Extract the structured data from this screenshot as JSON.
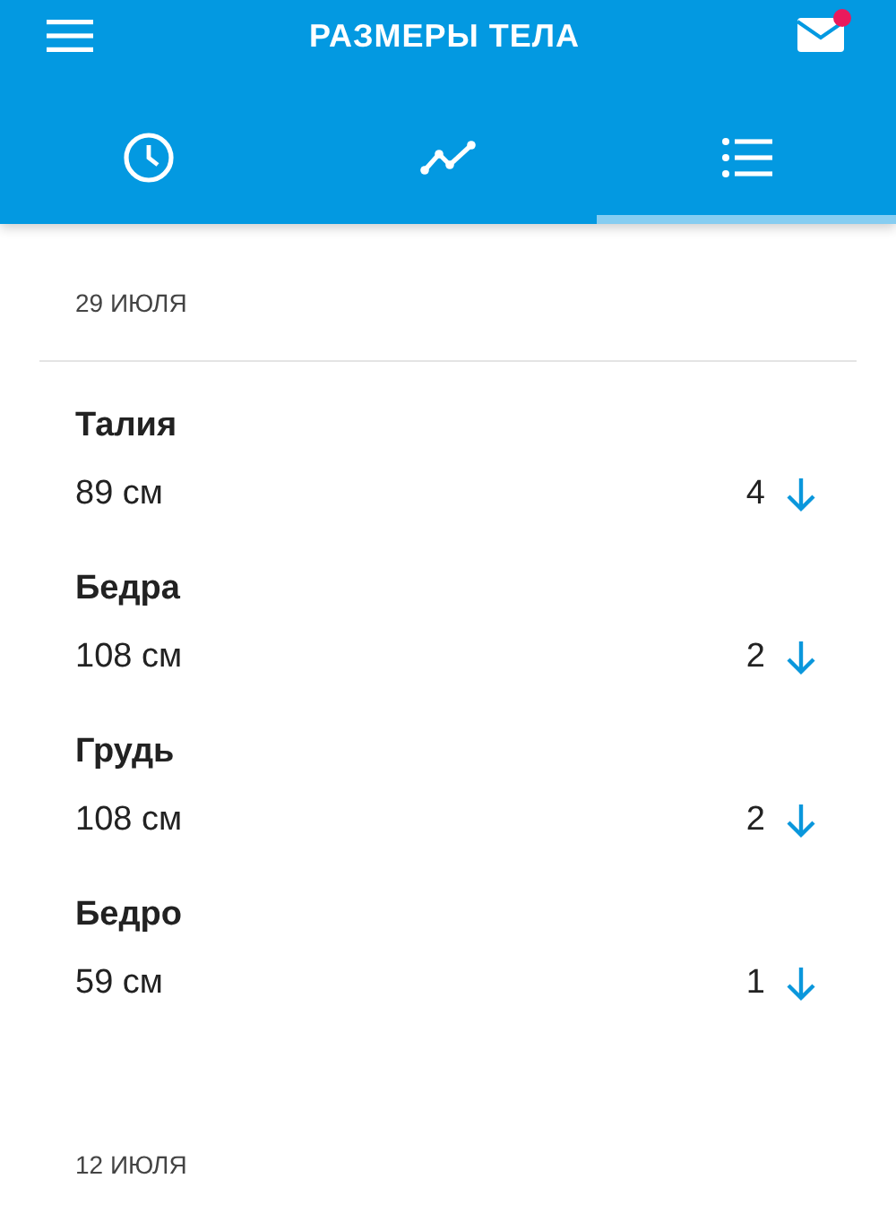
{
  "app_bar": {
    "title": "РАЗМЕРЫ ТЕЛА",
    "mail_unread": true
  },
  "tabs": [
    {
      "kind": "clock",
      "selected": false
    },
    {
      "kind": "chart",
      "selected": false
    },
    {
      "kind": "list",
      "selected": true
    }
  ],
  "sections": [
    {
      "date": "29 ИЮЛЯ",
      "entries": [
        {
          "name": "Талия",
          "value": "89 см",
          "change": "4",
          "decrease": true
        },
        {
          "name": "Бедра",
          "value": "108 см",
          "change": "2",
          "decrease": true
        },
        {
          "name": "Грудь",
          "value": "108 см",
          "change": "2",
          "decrease": true
        },
        {
          "name": "Бедро",
          "value": "59 см",
          "change": "1",
          "decrease": true
        }
      ]
    },
    {
      "date": "12 ИЮЛЯ"
    }
  ]
}
